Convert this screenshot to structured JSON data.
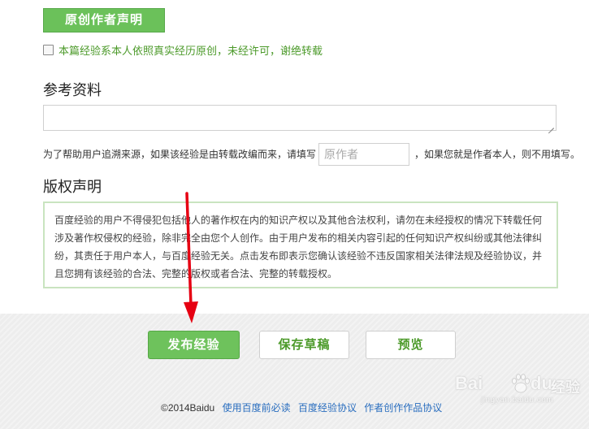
{
  "original_section": {
    "badge_label": "原创作者声明",
    "declare_label": "本篇经验系本人依照真实经历原创，未经许可，谢绝转载"
  },
  "reference_section": {
    "title": "参考资料",
    "trace_prefix": "为了帮助用户追溯来源，如果该经验是由转载改编而来，请填写",
    "author_placeholder": "原作者",
    "trace_suffix": "，如果您就是作者本人，则不用填写。"
  },
  "copyright_section": {
    "title": "版权声明",
    "text": "百度经验的用户不得侵犯包括他人的著作权在内的知识产权以及其他合法权利，请勿在未经授权的情况下转载任何涉及著作权侵权的经验，除非完全由您个人创作。由于用户发布的相关内容引起的任何知识产权纠纷或其他法律纠纷，其责任于用户本人，与百度经验无关。点击发布即表示您确认该经验不违反国家相关法律法规及经验协议，并且您拥有该经验的合法、完整的版权或者合法、完整的转载授权。"
  },
  "actions": {
    "publish_label": "发布经验",
    "save_draft_label": "保存草稿",
    "preview_label": "预览"
  },
  "footer": {
    "copyright": "©2014Baidu",
    "links": [
      "使用百度前必读",
      "百度经验协议",
      "作者创作作品协议"
    ]
  },
  "watermark": {
    "brand_prefix": "Bai",
    "brand_suffix": "du",
    "product": "经验",
    "url": "jingyan.baidu.com"
  },
  "colors": {
    "accent_green": "#6ec25c",
    "text_green": "#4c9a2a",
    "link_blue": "#2a6ebf",
    "arrow_red": "#e60012"
  }
}
